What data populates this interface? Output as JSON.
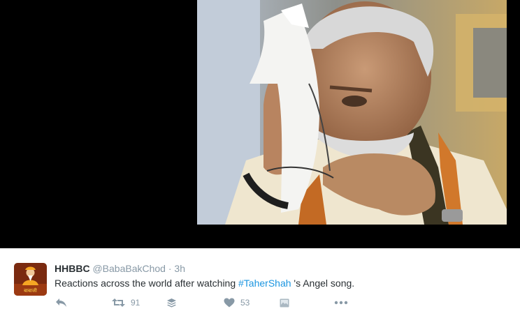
{
  "tweet": {
    "display_name": "HHBBC",
    "handle": "@BabaBakChod",
    "separator": "·",
    "timestamp": "3h",
    "text_before": "Reactions across the world after watching ",
    "hashtag": "#TaherShah",
    "text_after": " 's Angel song.",
    "avatar_caption": "बाबाजी"
  },
  "actions": {
    "reply_icon": "reply-icon",
    "retweet_icon": "retweet-icon",
    "retweet_count": "91",
    "buffer_icon": "layers-icon",
    "like_icon": "heart-icon",
    "like_count": "53",
    "media_icon": "image-icon",
    "more_icon": "ellipsis-icon"
  },
  "colors": {
    "text_primary": "#292f33",
    "text_secondary": "#8899a6",
    "hashtag": "#1b95e0",
    "media_background": "#000000"
  }
}
